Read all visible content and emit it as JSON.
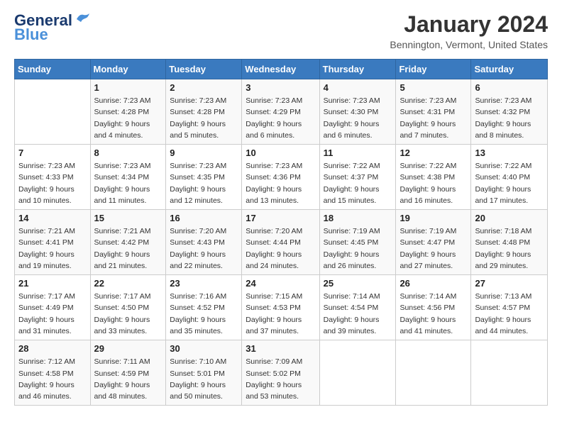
{
  "logo": {
    "line1": "General",
    "line2": "Blue"
  },
  "title": "January 2024",
  "location": "Bennington, Vermont, United States",
  "header_days": [
    "Sunday",
    "Monday",
    "Tuesday",
    "Wednesday",
    "Thursday",
    "Friday",
    "Saturday"
  ],
  "weeks": [
    [
      {
        "day": "",
        "info": ""
      },
      {
        "day": "1",
        "info": "Sunrise: 7:23 AM\nSunset: 4:28 PM\nDaylight: 9 hours\nand 4 minutes."
      },
      {
        "day": "2",
        "info": "Sunrise: 7:23 AM\nSunset: 4:28 PM\nDaylight: 9 hours\nand 5 minutes."
      },
      {
        "day": "3",
        "info": "Sunrise: 7:23 AM\nSunset: 4:29 PM\nDaylight: 9 hours\nand 6 minutes."
      },
      {
        "day": "4",
        "info": "Sunrise: 7:23 AM\nSunset: 4:30 PM\nDaylight: 9 hours\nand 6 minutes."
      },
      {
        "day": "5",
        "info": "Sunrise: 7:23 AM\nSunset: 4:31 PM\nDaylight: 9 hours\nand 7 minutes."
      },
      {
        "day": "6",
        "info": "Sunrise: 7:23 AM\nSunset: 4:32 PM\nDaylight: 9 hours\nand 8 minutes."
      }
    ],
    [
      {
        "day": "7",
        "info": "Sunrise: 7:23 AM\nSunset: 4:33 PM\nDaylight: 9 hours\nand 10 minutes."
      },
      {
        "day": "8",
        "info": "Sunrise: 7:23 AM\nSunset: 4:34 PM\nDaylight: 9 hours\nand 11 minutes."
      },
      {
        "day": "9",
        "info": "Sunrise: 7:23 AM\nSunset: 4:35 PM\nDaylight: 9 hours\nand 12 minutes."
      },
      {
        "day": "10",
        "info": "Sunrise: 7:23 AM\nSunset: 4:36 PM\nDaylight: 9 hours\nand 13 minutes."
      },
      {
        "day": "11",
        "info": "Sunrise: 7:22 AM\nSunset: 4:37 PM\nDaylight: 9 hours\nand 15 minutes."
      },
      {
        "day": "12",
        "info": "Sunrise: 7:22 AM\nSunset: 4:38 PM\nDaylight: 9 hours\nand 16 minutes."
      },
      {
        "day": "13",
        "info": "Sunrise: 7:22 AM\nSunset: 4:40 PM\nDaylight: 9 hours\nand 17 minutes."
      }
    ],
    [
      {
        "day": "14",
        "info": "Sunrise: 7:21 AM\nSunset: 4:41 PM\nDaylight: 9 hours\nand 19 minutes."
      },
      {
        "day": "15",
        "info": "Sunrise: 7:21 AM\nSunset: 4:42 PM\nDaylight: 9 hours\nand 21 minutes."
      },
      {
        "day": "16",
        "info": "Sunrise: 7:20 AM\nSunset: 4:43 PM\nDaylight: 9 hours\nand 22 minutes."
      },
      {
        "day": "17",
        "info": "Sunrise: 7:20 AM\nSunset: 4:44 PM\nDaylight: 9 hours\nand 24 minutes."
      },
      {
        "day": "18",
        "info": "Sunrise: 7:19 AM\nSunset: 4:45 PM\nDaylight: 9 hours\nand 26 minutes."
      },
      {
        "day": "19",
        "info": "Sunrise: 7:19 AM\nSunset: 4:47 PM\nDaylight: 9 hours\nand 27 minutes."
      },
      {
        "day": "20",
        "info": "Sunrise: 7:18 AM\nSunset: 4:48 PM\nDaylight: 9 hours\nand 29 minutes."
      }
    ],
    [
      {
        "day": "21",
        "info": "Sunrise: 7:17 AM\nSunset: 4:49 PM\nDaylight: 9 hours\nand 31 minutes."
      },
      {
        "day": "22",
        "info": "Sunrise: 7:17 AM\nSunset: 4:50 PM\nDaylight: 9 hours\nand 33 minutes."
      },
      {
        "day": "23",
        "info": "Sunrise: 7:16 AM\nSunset: 4:52 PM\nDaylight: 9 hours\nand 35 minutes."
      },
      {
        "day": "24",
        "info": "Sunrise: 7:15 AM\nSunset: 4:53 PM\nDaylight: 9 hours\nand 37 minutes."
      },
      {
        "day": "25",
        "info": "Sunrise: 7:14 AM\nSunset: 4:54 PM\nDaylight: 9 hours\nand 39 minutes."
      },
      {
        "day": "26",
        "info": "Sunrise: 7:14 AM\nSunset: 4:56 PM\nDaylight: 9 hours\nand 41 minutes."
      },
      {
        "day": "27",
        "info": "Sunrise: 7:13 AM\nSunset: 4:57 PM\nDaylight: 9 hours\nand 44 minutes."
      }
    ],
    [
      {
        "day": "28",
        "info": "Sunrise: 7:12 AM\nSunset: 4:58 PM\nDaylight: 9 hours\nand 46 minutes."
      },
      {
        "day": "29",
        "info": "Sunrise: 7:11 AM\nSunset: 4:59 PM\nDaylight: 9 hours\nand 48 minutes."
      },
      {
        "day": "30",
        "info": "Sunrise: 7:10 AM\nSunset: 5:01 PM\nDaylight: 9 hours\nand 50 minutes."
      },
      {
        "day": "31",
        "info": "Sunrise: 7:09 AM\nSunset: 5:02 PM\nDaylight: 9 hours\nand 53 minutes."
      },
      {
        "day": "",
        "info": ""
      },
      {
        "day": "",
        "info": ""
      },
      {
        "day": "",
        "info": ""
      }
    ]
  ]
}
